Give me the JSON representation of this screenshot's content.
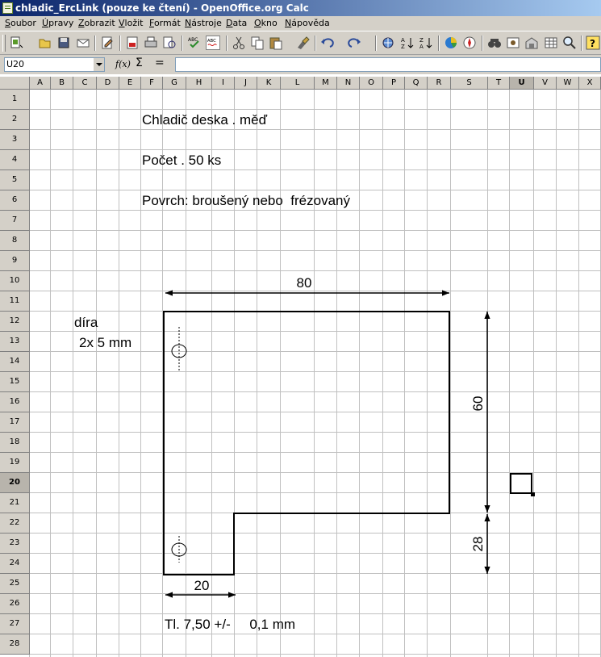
{
  "window": {
    "title": "chladic_ErcLink (pouze ke čtení) - OpenOffice.org Calc"
  },
  "menu": [
    "Soubor",
    "Úpravy",
    "Zobrazit",
    "Vložit",
    "Formát",
    "Nástroje",
    "Data",
    "Okno",
    "Nápověda"
  ],
  "toolbar": {
    "icons": [
      "new-document-icon",
      "open-icon",
      "save-icon",
      "email-icon",
      "edit-file-icon",
      "export-pdf-icon",
      "print-icon",
      "page-preview-icon",
      "spellcheck-icon",
      "autospellcheck-icon",
      "cut-icon",
      "copy-icon",
      "paste-icon",
      "clone-format-icon",
      "undo-icon",
      "redo-icon",
      "hyperlink-icon",
      "sort-ascending-icon",
      "sort-descending-icon",
      "chart-icon",
      "navigator-icon",
      "find-icon",
      "gallery-icon",
      "datasource-icon",
      "zoom-icon",
      "help-icon"
    ]
  },
  "formula_bar": {
    "name_box": "U20",
    "fx_label": "f(x)",
    "sum_label": "Σ",
    "equals_label": "=",
    "formula": ""
  },
  "columns": [
    "A",
    "B",
    "C",
    "D",
    "E",
    "F",
    "G",
    "H",
    "I",
    "J",
    "K",
    "L",
    "M",
    "N",
    "O",
    "P",
    "Q",
    "R",
    "S",
    "T",
    "U",
    "V",
    "W",
    "X"
  ],
  "selected_column": "U",
  "rows": [
    "1",
    "2",
    "3",
    "4",
    "5",
    "6",
    "7",
    "8",
    "9",
    "10",
    "11",
    "12",
    "13",
    "14",
    "15",
    "16",
    "17",
    "18",
    "19",
    "20",
    "21",
    "22",
    "23",
    "24",
    "25",
    "26",
    "27",
    "28"
  ],
  "selected_row": "20",
  "cells": {
    "title": "Chladič deska . měď",
    "count": "Počet . 50 ks",
    "surface": "Povrch: broušený nebo  frézovaný",
    "hole_label": "díra",
    "hole_size": "2x 5 mm",
    "thickness": "Tl. 7,50 +/-     0,1 mm"
  },
  "drawing": {
    "dim_width": "80",
    "dim_height": "60",
    "dim_step": "28",
    "dim_foot": "20"
  }
}
